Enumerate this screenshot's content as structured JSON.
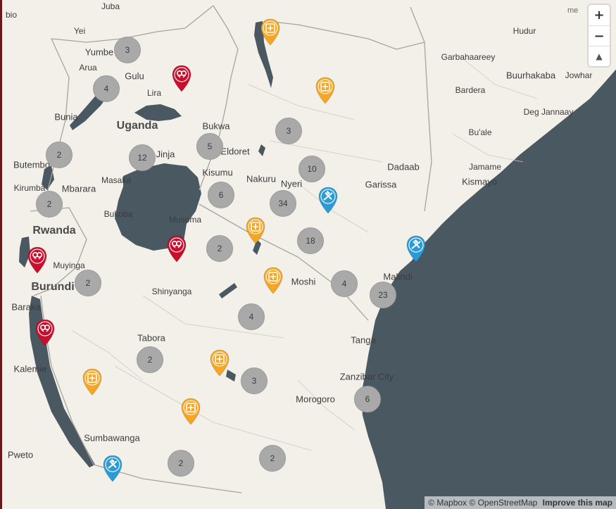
{
  "places": [
    {
      "name": "Juba",
      "size": "s"
    },
    {
      "name": "Yei",
      "size": "s"
    },
    {
      "name": "Yumbe",
      "size": "m"
    },
    {
      "name": "Arua",
      "size": "s"
    },
    {
      "name": "Gulu",
      "size": "m"
    },
    {
      "name": "Lira",
      "size": "s"
    },
    {
      "name": "Uganda",
      "size": "country"
    },
    {
      "name": "Bunia",
      "size": "m"
    },
    {
      "name": "Butembo",
      "size": "m"
    },
    {
      "name": "Kirumba",
      "size": "s"
    },
    {
      "name": "Mbarara",
      "size": "m"
    },
    {
      "name": "Masaka",
      "size": "s"
    },
    {
      "name": "Jinja",
      "size": "m"
    },
    {
      "name": "Bukwa",
      "size": "m"
    },
    {
      "name": "Eldoret",
      "size": "m"
    },
    {
      "name": "Kisumu",
      "size": "m"
    },
    {
      "name": "Nakuru",
      "size": "m"
    },
    {
      "name": "Nyeri",
      "size": "m"
    },
    {
      "name": "Bukoba",
      "size": "s"
    },
    {
      "name": "Rwanda",
      "size": "country"
    },
    {
      "name": "Musoma",
      "size": "s"
    },
    {
      "name": "Muyinga",
      "size": "s"
    },
    {
      "name": "Burundi",
      "size": "country"
    },
    {
      "name": "Shinyanga",
      "size": "s"
    },
    {
      "name": "Baraka",
      "size": "m"
    },
    {
      "name": "Tabora",
      "size": "m"
    },
    {
      "name": "Kalemie",
      "size": "m"
    },
    {
      "name": "Moshi",
      "size": "m"
    },
    {
      "name": "Tanga",
      "size": "m"
    },
    {
      "name": "Zanzibar City",
      "size": "m"
    },
    {
      "name": "Morogoro",
      "size": "m"
    },
    {
      "name": "Sumbawanga",
      "size": "m"
    },
    {
      "name": "Pweto",
      "size": "m"
    },
    {
      "name": "Hudur",
      "size": "s"
    },
    {
      "name": "Garbahaareey",
      "size": "s"
    },
    {
      "name": "Buurhakaba",
      "size": "m"
    },
    {
      "name": "Jowhar",
      "size": "s"
    },
    {
      "name": "Bardera",
      "size": "s"
    },
    {
      "name": "Deg Jannaay",
      "size": "s"
    },
    {
      "name": "Bu'ale",
      "size": "s"
    },
    {
      "name": "Jamame",
      "size": "s"
    },
    {
      "name": "Dadaab",
      "size": "m"
    },
    {
      "name": "Kismayo",
      "size": "m"
    },
    {
      "name": "Garissa",
      "size": "m"
    },
    {
      "name": "Malindi",
      "size": "m"
    },
    {
      "name": "bio",
      "size": "s"
    }
  ],
  "clusters": [
    "3",
    "4",
    "12",
    "2",
    "2",
    "5",
    "6",
    "3",
    "34",
    "10",
    "18",
    "2",
    "2",
    "4",
    "4",
    "23",
    "2",
    "3",
    "6",
    "2",
    "2"
  ],
  "markers": [
    {
      "kind": "rights",
      "color": "#c8102e"
    },
    {
      "kind": "rights",
      "color": "#c8102e"
    },
    {
      "kind": "rights",
      "color": "#c8102e"
    },
    {
      "kind": "rights",
      "color": "#c8102e"
    },
    {
      "kind": "cross",
      "color": "#f5a623"
    },
    {
      "kind": "cross",
      "color": "#f5a623"
    },
    {
      "kind": "cross",
      "color": "#f5a623"
    },
    {
      "kind": "cross",
      "color": "#f5a623"
    },
    {
      "kind": "cross",
      "color": "#f5a623"
    },
    {
      "kind": "cross",
      "color": "#f5a623"
    },
    {
      "kind": "cross",
      "color": "#f5a623"
    },
    {
      "kind": "aid",
      "color": "#2b9bd6"
    },
    {
      "kind": "aid",
      "color": "#2b9bd6"
    },
    {
      "kind": "aid",
      "color": "#2b9bd6"
    }
  ],
  "controls": {
    "zoom_in": "+",
    "zoom_out": "−",
    "compass": "▲"
  },
  "broken_image_alt": "me",
  "attribution": {
    "mapbox": "© Mapbox",
    "osm": "© OpenStreetMap",
    "improve": "Improve this map"
  },
  "colors": {
    "water": "#4a5862",
    "land": "#f3f0ea",
    "cluster": "#a9a9a9",
    "rights": "#c8102e",
    "cross": "#f5a623",
    "aid": "#2b9bd6"
  }
}
